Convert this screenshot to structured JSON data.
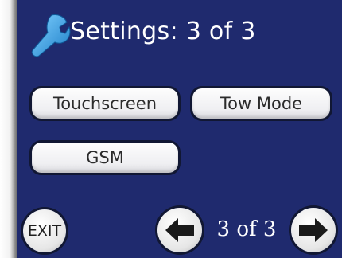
{
  "header": {
    "title": "Settings: 3 of 3",
    "icon": "wrench-icon"
  },
  "buttons": {
    "touchscreen": "Touchscreen",
    "tow_mode": "Tow Mode",
    "gsm": "GSM"
  },
  "footer": {
    "exit_label": "EXIT",
    "page_indicator": "3 of 3",
    "prev_icon": "arrow-left-icon",
    "next_icon": "arrow-right-icon"
  },
  "colors": {
    "screen_bg": "#1f2a6e",
    "wrench": "#3aa6e6",
    "button_face": "#f3f3f5",
    "text_light": "#ffffff",
    "text_dark": "#2b2b2b"
  }
}
